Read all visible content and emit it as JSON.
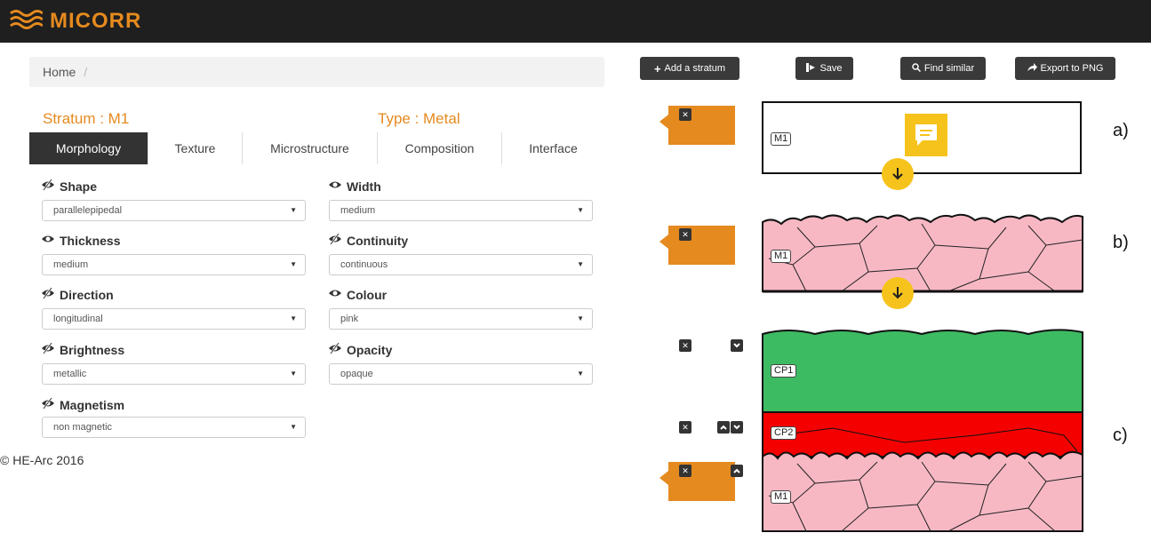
{
  "app": {
    "title": "MICORR",
    "brand_color": "#e58a1f"
  },
  "breadcrumb": {
    "home_label": "Home",
    "separator": "/"
  },
  "stratum": {
    "name_text": "Stratum : M1",
    "type_text": "Type : Metal"
  },
  "tabs": [
    {
      "label": "Morphology",
      "active": true
    },
    {
      "label": "Texture",
      "active": false
    },
    {
      "label": "Microstructure",
      "active": false
    },
    {
      "label": "Composition",
      "active": false
    },
    {
      "label": "Interface",
      "active": false
    }
  ],
  "fields": {
    "shape": {
      "label": "Shape",
      "value": "parallelepipedal",
      "icon": "eye-slash-icon"
    },
    "width": {
      "label": "Width",
      "value": "medium",
      "icon": "eye-icon"
    },
    "thickness": {
      "label": "Thickness",
      "value": "medium",
      "icon": "eye-icon"
    },
    "continuity": {
      "label": "Continuity",
      "value": "continuous",
      "icon": "eye-slash-icon"
    },
    "direction": {
      "label": "Direction",
      "value": "longitudinal",
      "icon": "eye-slash-icon"
    },
    "colour": {
      "label": "Colour",
      "value": "pink",
      "icon": "eye-icon"
    },
    "brightness": {
      "label": "Brightness",
      "value": "metallic",
      "icon": "eye-slash-icon"
    },
    "opacity": {
      "label": "Opacity",
      "value": "opaque",
      "icon": "eye-slash-icon"
    },
    "magnetism": {
      "label": "Magnetism",
      "value": "non magnetic",
      "icon": "eye-slash-icon"
    }
  },
  "footer": {
    "copyright": "© HE-Arc 2016"
  },
  "toolbar": {
    "add_stratum": "Add a stratum",
    "save": "Save",
    "find_similar": "Find similar",
    "export_png": "Export to PNG"
  },
  "diagram": {
    "panel_a_letter": "a)",
    "panel_b_letter": "b)",
    "panel_c_letter": "c)",
    "m1_label": "M1",
    "cp1_label": "CP1",
    "cp2_label": "CP2",
    "pink_color": "#f7b8c4",
    "green_color": "#3dbb63",
    "red_color": "#f50000",
    "yellow_color": "#f6c31c"
  }
}
